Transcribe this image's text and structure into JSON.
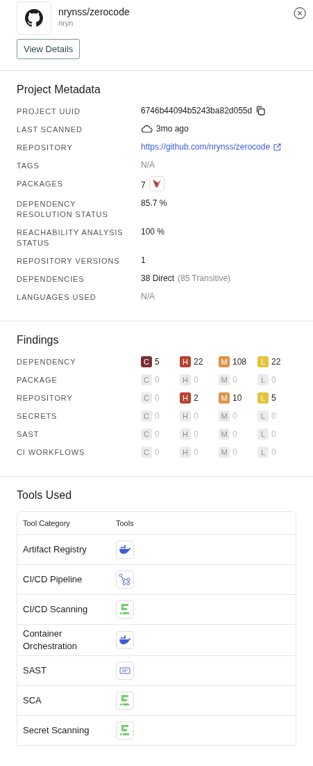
{
  "header": {
    "title": "nrynss/zerocode",
    "subtitle": "nryn",
    "button": "View Details"
  },
  "metadata": {
    "title": "Project Metadata",
    "rows": [
      {
        "label": "PROJECT UUID",
        "kind": "copy",
        "value": "6746b44094b5243ba82d055d"
      },
      {
        "label": "LAST SCANNED",
        "kind": "cloud",
        "value": "3mo ago"
      },
      {
        "label": "REPOSITORY",
        "kind": "link",
        "value": "https://github.com/nrynss/zerocode"
      },
      {
        "label": "TAGS",
        "kind": "muted",
        "value": "N/A"
      },
      {
        "label": "PACKAGES",
        "kind": "packages",
        "value": "7"
      },
      {
        "label": "DEPENDENCY RESOLUTION STATUS",
        "kind": "text",
        "value": "85.7 %"
      },
      {
        "label": "REACHABILITY ANALYSIS STATUS",
        "kind": "text",
        "value": "100 %"
      },
      {
        "label": "REPOSITORY VERSIONS",
        "kind": "text",
        "value": "1"
      },
      {
        "label": "DEPENDENCIES",
        "kind": "split",
        "value": "38 Direct",
        "secondary": "(85 Transitive)"
      },
      {
        "label": "LANGUAGES USED",
        "kind": "muted",
        "value": "N/A"
      }
    ]
  },
  "findings": {
    "title": "Findings",
    "rows": [
      {
        "label": "DEPENDENCY",
        "counts": [
          {
            "kind": "critical",
            "letter": "C",
            "count": "5",
            "active": true
          },
          {
            "kind": "high",
            "letter": "H",
            "count": "22",
            "active": true
          },
          {
            "kind": "medium",
            "letter": "M",
            "count": "108",
            "active": true
          },
          {
            "kind": "low",
            "letter": "L",
            "count": "22",
            "active": true
          }
        ]
      },
      {
        "label": "PACKAGE",
        "counts": [
          {
            "kind": "critical",
            "letter": "C",
            "count": "0",
            "active": false
          },
          {
            "kind": "high",
            "letter": "H",
            "count": "0",
            "active": false
          },
          {
            "kind": "medium",
            "letter": "M",
            "count": "0",
            "active": false
          },
          {
            "kind": "low",
            "letter": "L",
            "count": "0",
            "active": false
          }
        ]
      },
      {
        "label": "REPOSITORY",
        "counts": [
          {
            "kind": "critical",
            "letter": "C",
            "count": "0",
            "active": false
          },
          {
            "kind": "high",
            "letter": "H",
            "count": "2",
            "active": true
          },
          {
            "kind": "medium",
            "letter": "M",
            "count": "10",
            "active": true
          },
          {
            "kind": "low",
            "letter": "L",
            "count": "5",
            "active": true
          }
        ]
      },
      {
        "label": "SECRETS",
        "counts": [
          {
            "kind": "critical",
            "letter": "C",
            "count": "0",
            "active": false
          },
          {
            "kind": "high",
            "letter": "H",
            "count": "0",
            "active": false
          },
          {
            "kind": "medium",
            "letter": "M",
            "count": "0",
            "active": false
          },
          {
            "kind": "low",
            "letter": "L",
            "count": "0",
            "active": false
          }
        ]
      },
      {
        "label": "SAST",
        "counts": [
          {
            "kind": "critical",
            "letter": "C",
            "count": "0",
            "active": false
          },
          {
            "kind": "high",
            "letter": "H",
            "count": "0",
            "active": false
          },
          {
            "kind": "medium",
            "letter": "M",
            "count": "0",
            "active": false
          },
          {
            "kind": "low",
            "letter": "L",
            "count": "0",
            "active": false
          }
        ]
      },
      {
        "label": "CI WORKFLOWS",
        "counts": [
          {
            "kind": "critical",
            "letter": "C",
            "count": "0",
            "active": false
          },
          {
            "kind": "high",
            "letter": "H",
            "count": "0",
            "active": false
          },
          {
            "kind": "medium",
            "letter": "M",
            "count": "0",
            "active": false
          },
          {
            "kind": "low",
            "letter": "L",
            "count": "0",
            "active": false
          }
        ]
      }
    ]
  },
  "tools": {
    "title": "Tools Used",
    "columns": [
      "Tool Category",
      "Tools"
    ],
    "rows": [
      {
        "category": "Artifact Registry",
        "kind": "whale"
      },
      {
        "category": "CI/CD Pipeline",
        "kind": "pipeline"
      },
      {
        "category": "CI/CD Scanning",
        "kind": "blocks"
      },
      {
        "category": "Container Orchestration",
        "kind": "whale"
      },
      {
        "category": "SAST",
        "kind": "tag"
      },
      {
        "category": "SCA",
        "kind": "blocks"
      },
      {
        "category": "Secret Scanning",
        "kind": "blocks"
      }
    ]
  }
}
